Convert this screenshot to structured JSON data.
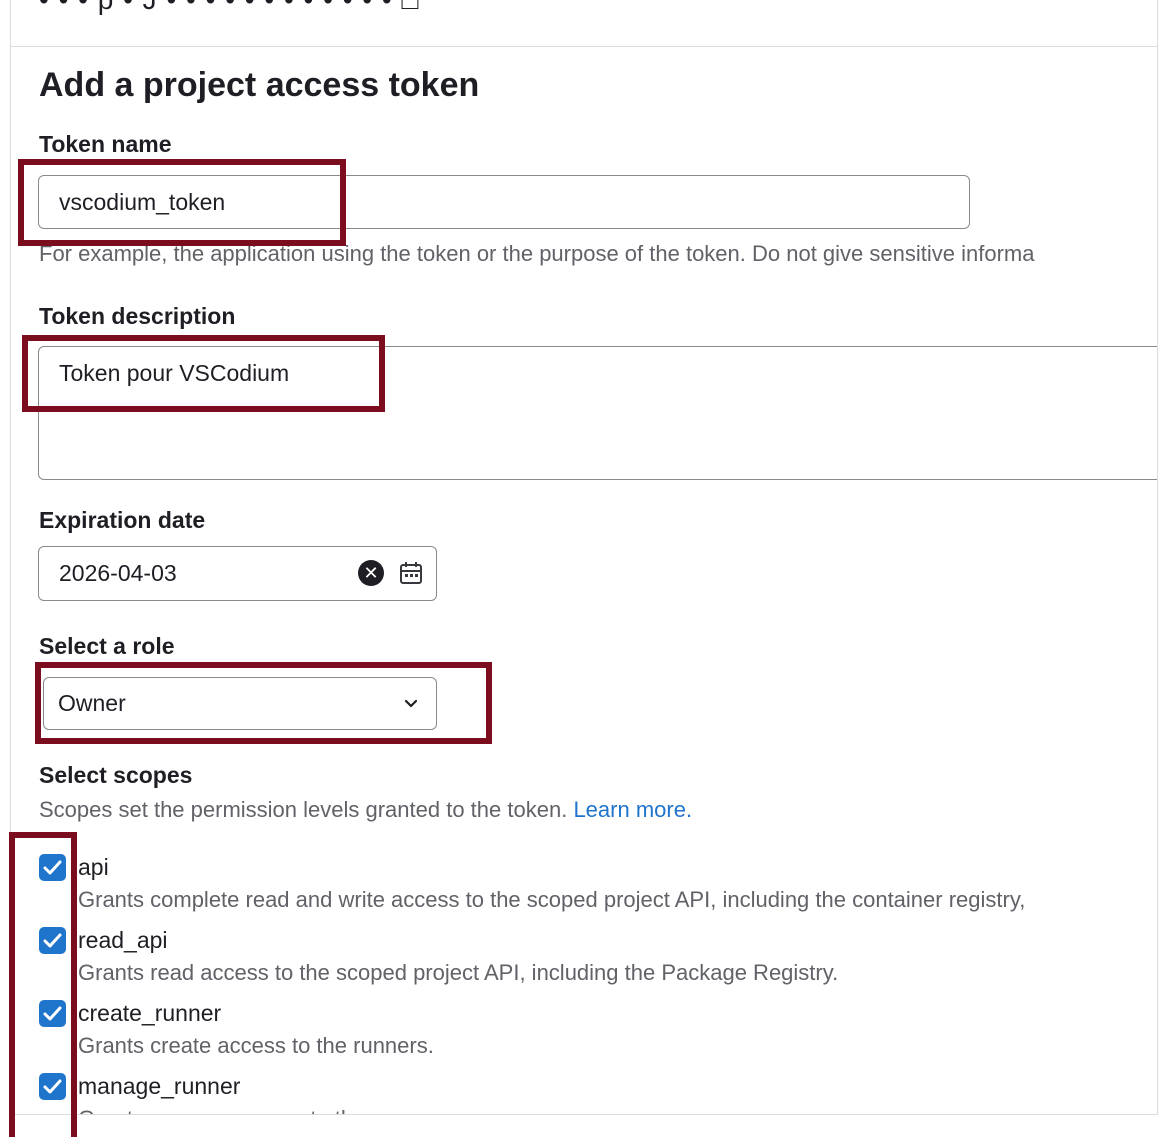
{
  "header": {
    "cropped_text": "• • • p • J • • • • • • • • • • • • □"
  },
  "form": {
    "title": "Add a project access token",
    "token_name": {
      "label": "Token name",
      "value": "vscodium_token",
      "help": "For example, the application using the token or the purpose of the token. Do not give sensitive informa"
    },
    "token_description": {
      "label": "Token description",
      "value": "Token pour VSCodium"
    },
    "expiration": {
      "label": "Expiration date",
      "value": "2026-04-03",
      "clear_icon": "clear-circle-icon",
      "calendar_icon": "calendar-icon"
    },
    "role": {
      "label": "Select a role",
      "value": "Owner",
      "chevron_icon": "chevron-down-icon"
    },
    "scopes": {
      "label": "Select scopes",
      "help": "Scopes set the permission levels granted to the token.",
      "learn_more": "Learn more.",
      "items": [
        {
          "name": "api",
          "checked": true,
          "description": "Grants complete read and write access to the scoped project API, including the container registry,"
        },
        {
          "name": "read_api",
          "checked": true,
          "description": "Grants read access to the scoped project API, including the Package Registry."
        },
        {
          "name": "create_runner",
          "checked": true,
          "description": "Grants create access to the runners."
        },
        {
          "name": "manage_runner",
          "checked": true,
          "description": "Grants manage access to the runners."
        }
      ]
    }
  },
  "colors": {
    "highlight": "#7b0d1e",
    "checkbox": "#1f75cb",
    "link": "#1f75cb"
  }
}
